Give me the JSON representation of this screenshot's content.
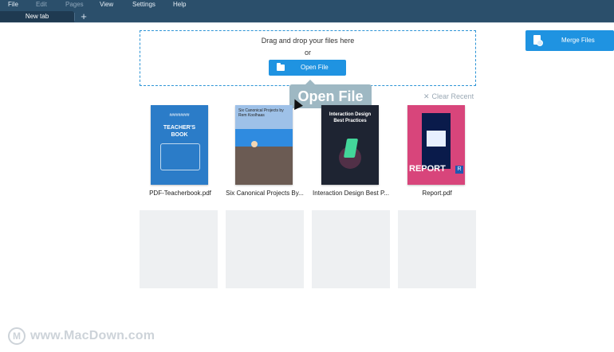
{
  "menubar": {
    "items": [
      "File",
      "Edit",
      "Pages",
      "View",
      "Settings",
      "Help"
    ]
  },
  "tabs": {
    "current": "New tab",
    "add_label": "+"
  },
  "dropzone": {
    "title": "Drag and drop your files here",
    "or": "or",
    "open_button": "Open File"
  },
  "tooltip": {
    "text": "Open File"
  },
  "merge": {
    "label": "Merge Files"
  },
  "recent": {
    "clear_label": "Clear Recent",
    "files": [
      {
        "name": "PDF-Teacherbook.pdf"
      },
      {
        "name": "Six Canonical Projects By..."
      },
      {
        "name": "Interaction Design Best P..."
      },
      {
        "name": "Report.pdf"
      }
    ]
  },
  "thumb_text": {
    "t1_brand": "#########",
    "t1_title_line1": "TEACHER'S",
    "t1_title_line2": "BOOK",
    "t2_title": "Six Canonical Projects by Rem Koolhaas",
    "t3_title": "Interaction Design Best Practices",
    "t4_report": "REPORT",
    "t4_r": "R"
  },
  "watermark": {
    "text": "www.MacDown.com"
  },
  "colors": {
    "topbar": "#2b4f6b",
    "accent": "#1f93e1",
    "dropzone_border": "#2c94d6"
  }
}
